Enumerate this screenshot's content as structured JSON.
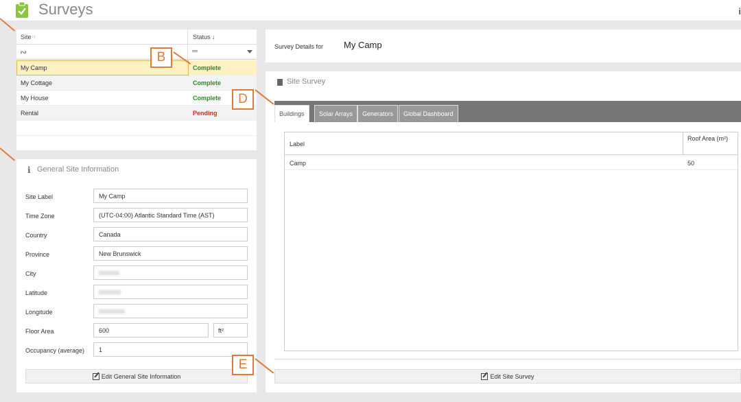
{
  "app": {
    "title": "Surveys",
    "icon": "clipboard-check-icon",
    "info_icon": "info-icon",
    "accent": "#8cc63f"
  },
  "grid": {
    "col_site": "Site",
    "col_status": "Status",
    "sort_site_icon": "arrow-up-icon",
    "sort_status_icon": "arrow-down-icon",
    "filter_site": "∾",
    "filter_status": "═",
    "rows": [
      {
        "site": "My Camp",
        "status": "Complete",
        "status_color": "#2a8a2a",
        "selected": true
      },
      {
        "site": "My Cottage",
        "status": "Complete",
        "status_color": "#2a8a2a"
      },
      {
        "site": "My House",
        "status": "Complete",
        "status_color": "#2a8a2a"
      },
      {
        "site": "Rental",
        "status": "Pending",
        "status_color": "#e02020"
      }
    ]
  },
  "general": {
    "title": "General Site Information",
    "icon": "info-icon",
    "fields": [
      {
        "label": "Site Label",
        "value": "My Camp"
      },
      {
        "label": "Time Zone",
        "value": "(UTC-04:00) Atlantic Standard Time (AST)"
      },
      {
        "label": "Country",
        "value": "Canada"
      },
      {
        "label": "Province",
        "value": "New Brunswick"
      },
      {
        "label": "City",
        "value": ""
      },
      {
        "label": "Latitude",
        "value": ""
      },
      {
        "label": "Longitude",
        "value": ""
      },
      {
        "label": "Floor Area",
        "value": "600",
        "unit": "ft²"
      },
      {
        "label": "Occupancy (average)",
        "value": "1"
      }
    ],
    "edit_label": "Edit General Site Information"
  },
  "details": {
    "label": "Survey Details for",
    "value": "My Camp"
  },
  "survey": {
    "title": "Site Survey",
    "tabs": [
      "Buildings",
      "Solar Arrays",
      "Generators",
      "Global Dashboard"
    ],
    "active_tab": "Buildings",
    "table": {
      "col_label": "Label",
      "col_roof": "Roof Area (m²)",
      "rows": [
        {
          "label": "Camp",
          "roof": "50"
        }
      ]
    },
    "edit_label": "Edit Site Survey"
  },
  "callouts": {
    "b": "B",
    "d": "D",
    "e": "E",
    "color": "#e07a3a"
  }
}
